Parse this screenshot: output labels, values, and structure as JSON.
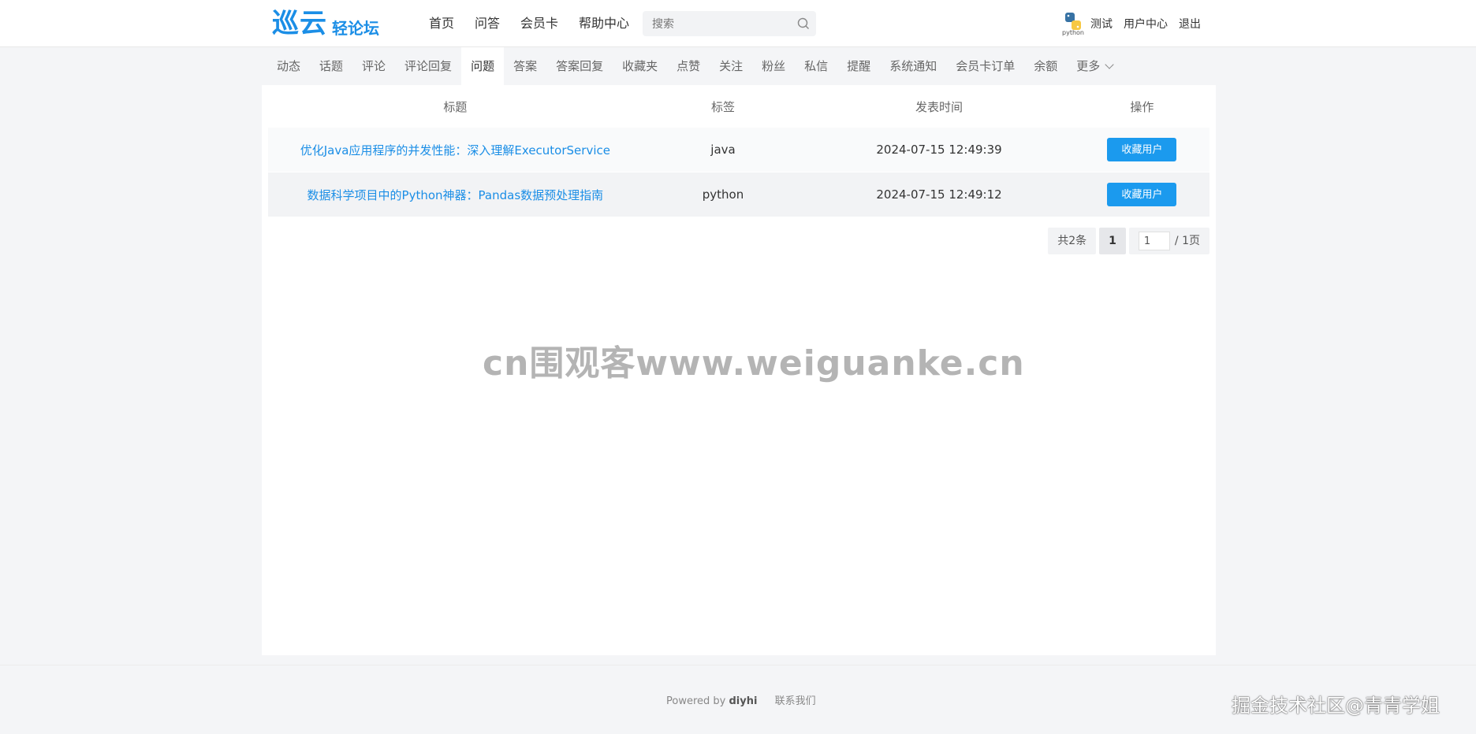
{
  "header": {
    "logo_main": "巡云",
    "logo_sub": "轻论坛",
    "nav": [
      "首页",
      "问答",
      "会员卡",
      "帮助中心"
    ],
    "search_placeholder": "搜索",
    "avatar_text": "python",
    "user_name": "测试",
    "user_center": "用户中心",
    "logout": "退出"
  },
  "tabs": {
    "items": [
      "动态",
      "话题",
      "评论",
      "评论回复",
      "问题",
      "答案",
      "答案回复",
      "收藏夹",
      "点赞",
      "关注",
      "粉丝",
      "私信",
      "提醒",
      "系统通知",
      "会员卡订单",
      "余额",
      "更多"
    ],
    "active": "问题"
  },
  "table": {
    "headers": [
      "标题",
      "标签",
      "发表时间",
      "操作"
    ],
    "rows": [
      {
        "title": "优化Java应用程序的并发性能：深入理解ExecutorService",
        "tag": "java",
        "time": "2024-07-15 12:49:39",
        "action": "收藏用户"
      },
      {
        "title": "数据科学项目中的Python神器：Pandas数据预处理指南",
        "tag": "python",
        "time": "2024-07-15 12:49:12",
        "action": "收藏用户"
      }
    ]
  },
  "pager": {
    "total": "共2条",
    "current": "1",
    "jump_value": "1",
    "pages": "/ 1页"
  },
  "watermark": "cn围观客www.weiguanke.cn",
  "footer": {
    "powered": "Powered by",
    "brand": "diyhi",
    "contact": "联系我们"
  },
  "corner_watermark": "掘金技术社区@青青学姐",
  "colors": {
    "accent": "#1b8ee6",
    "button": "#1b9aee",
    "bg": "#f4f5f7"
  }
}
